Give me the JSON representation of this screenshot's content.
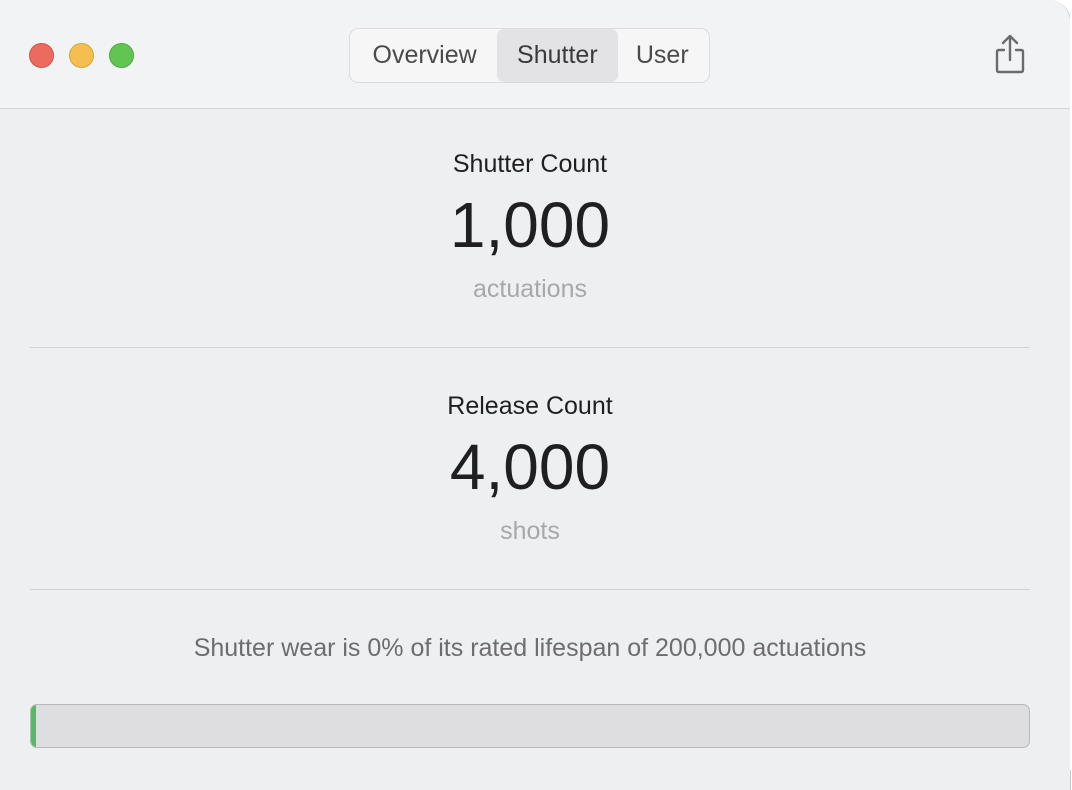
{
  "tabs": [
    {
      "label": "Overview",
      "selected": false
    },
    {
      "label": "Shutter",
      "selected": true
    },
    {
      "label": "User",
      "selected": false
    }
  ],
  "shutter_count": {
    "label": "Shutter Count",
    "value": "1,000",
    "unit": "actuations"
  },
  "release_count": {
    "label": "Release Count",
    "value": "4,000",
    "unit": "shots"
  },
  "wear": {
    "text": "Shutter wear is 0% of its rated lifespan of 200,000 actuations",
    "progress_fraction": 0.005,
    "fill_color": "#59b66b"
  },
  "icons": {
    "share": "share-icon",
    "close": "window-close-icon",
    "minimize": "window-minimize-icon",
    "zoom": "window-zoom-icon"
  }
}
